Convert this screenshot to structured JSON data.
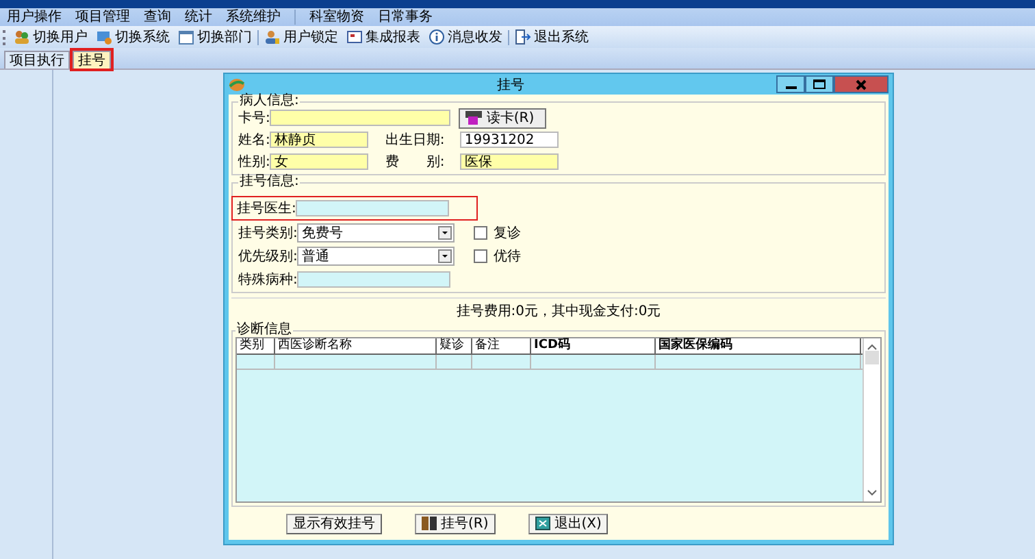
{
  "menu": [
    "用户操作",
    "项目管理",
    "查询",
    "统计",
    "系统维护",
    "科室物资",
    "日常事务"
  ],
  "toolbar": [
    {
      "label": "切换用户",
      "kind": "users"
    },
    {
      "label": "切换系统",
      "kind": "switch"
    },
    {
      "label": "切换部门",
      "kind": "dept"
    },
    {
      "label": "用户锁定",
      "kind": "lock"
    },
    {
      "label": "集成报表",
      "kind": "report"
    },
    {
      "label": "消息收发",
      "kind": "message"
    },
    {
      "label": "退出系统",
      "kind": "exit"
    }
  ],
  "tabs": [
    {
      "label": "项目执行",
      "selected": false,
      "highlighted": false
    },
    {
      "label": "挂号",
      "selected": true,
      "highlighted": true
    }
  ],
  "dialog": {
    "title": "挂号",
    "patient": {
      "legend": "病人信息:",
      "card_label": "卡号:",
      "read_card_button": "读卡(R)",
      "name_label": "姓名:",
      "name": "林静贞",
      "birth_label": "出生日期:",
      "birth": "19931202",
      "sex_label": "性别:",
      "sex": "女",
      "fee_type_label": "费　　别:",
      "fee_type": "医保"
    },
    "registration": {
      "legend": "挂号信息:",
      "doctor_label": "挂号医生:",
      "doctor_highlighted": true,
      "category_label": "挂号类别:",
      "category": "免费号",
      "followup_label": "复诊",
      "followup_checked": false,
      "priority_label": "优先级别:",
      "priority": "普通",
      "vip_label": "优待",
      "vip_checked": false,
      "disease_label": "特殊病种:"
    },
    "fee_summary": "挂号费用:0元，其中现金支付:0元",
    "diagnosis": {
      "legend": "诊断信息",
      "columns": [
        "类别",
        "西医诊断名称",
        "疑诊",
        "备注",
        "ICD码",
        "国家医保编码"
      ]
    },
    "buttons": [
      {
        "label": "显示有效挂号",
        "kind": "plain"
      },
      {
        "label": "挂号(R)",
        "kind": "register"
      },
      {
        "label": "退出(X)",
        "kind": "exit"
      }
    ]
  }
}
